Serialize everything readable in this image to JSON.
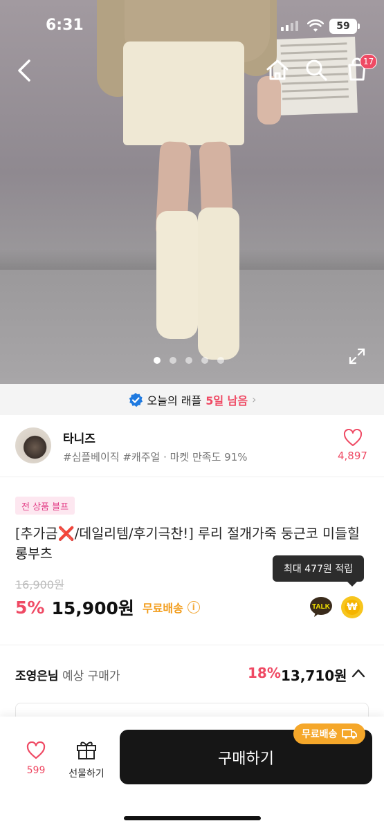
{
  "status_bar": {
    "time": "6:31",
    "battery": "59"
  },
  "nav": {
    "cart_count": "17"
  },
  "gallery": {
    "total_images": 5,
    "current_index": 0
  },
  "raffle": {
    "label": "오늘의 래플",
    "days_left": "5일 남음"
  },
  "store": {
    "name": "타니즈",
    "tags": "#심플베이직 #캐주얼 · 마켓 만족도 91%",
    "likes": "4,897"
  },
  "product": {
    "badge": "전 상품 블프",
    "title_prefix": "[추가금",
    "title_x": "❌",
    "title_rest": "/데일리템/후기극찬!] 루리 절개가죽 둥근코 미들힐 롱부츠",
    "original_price": "16,900원",
    "discount": "5%",
    "price": "15,900원",
    "free_shipping": "무료배송",
    "points_tooltip": "최대 477원 적립",
    "talk_label": "TALK",
    "points_symbol": "₩"
  },
  "expected_price": {
    "user": "조영은님",
    "label": " 예상 구매가",
    "discount": "18%",
    "price": "13,710원"
  },
  "bottom_bar": {
    "likes": "599",
    "gift_label": "선물하기",
    "buy_label": "구매하기",
    "shipping_pill": "무료배송"
  }
}
